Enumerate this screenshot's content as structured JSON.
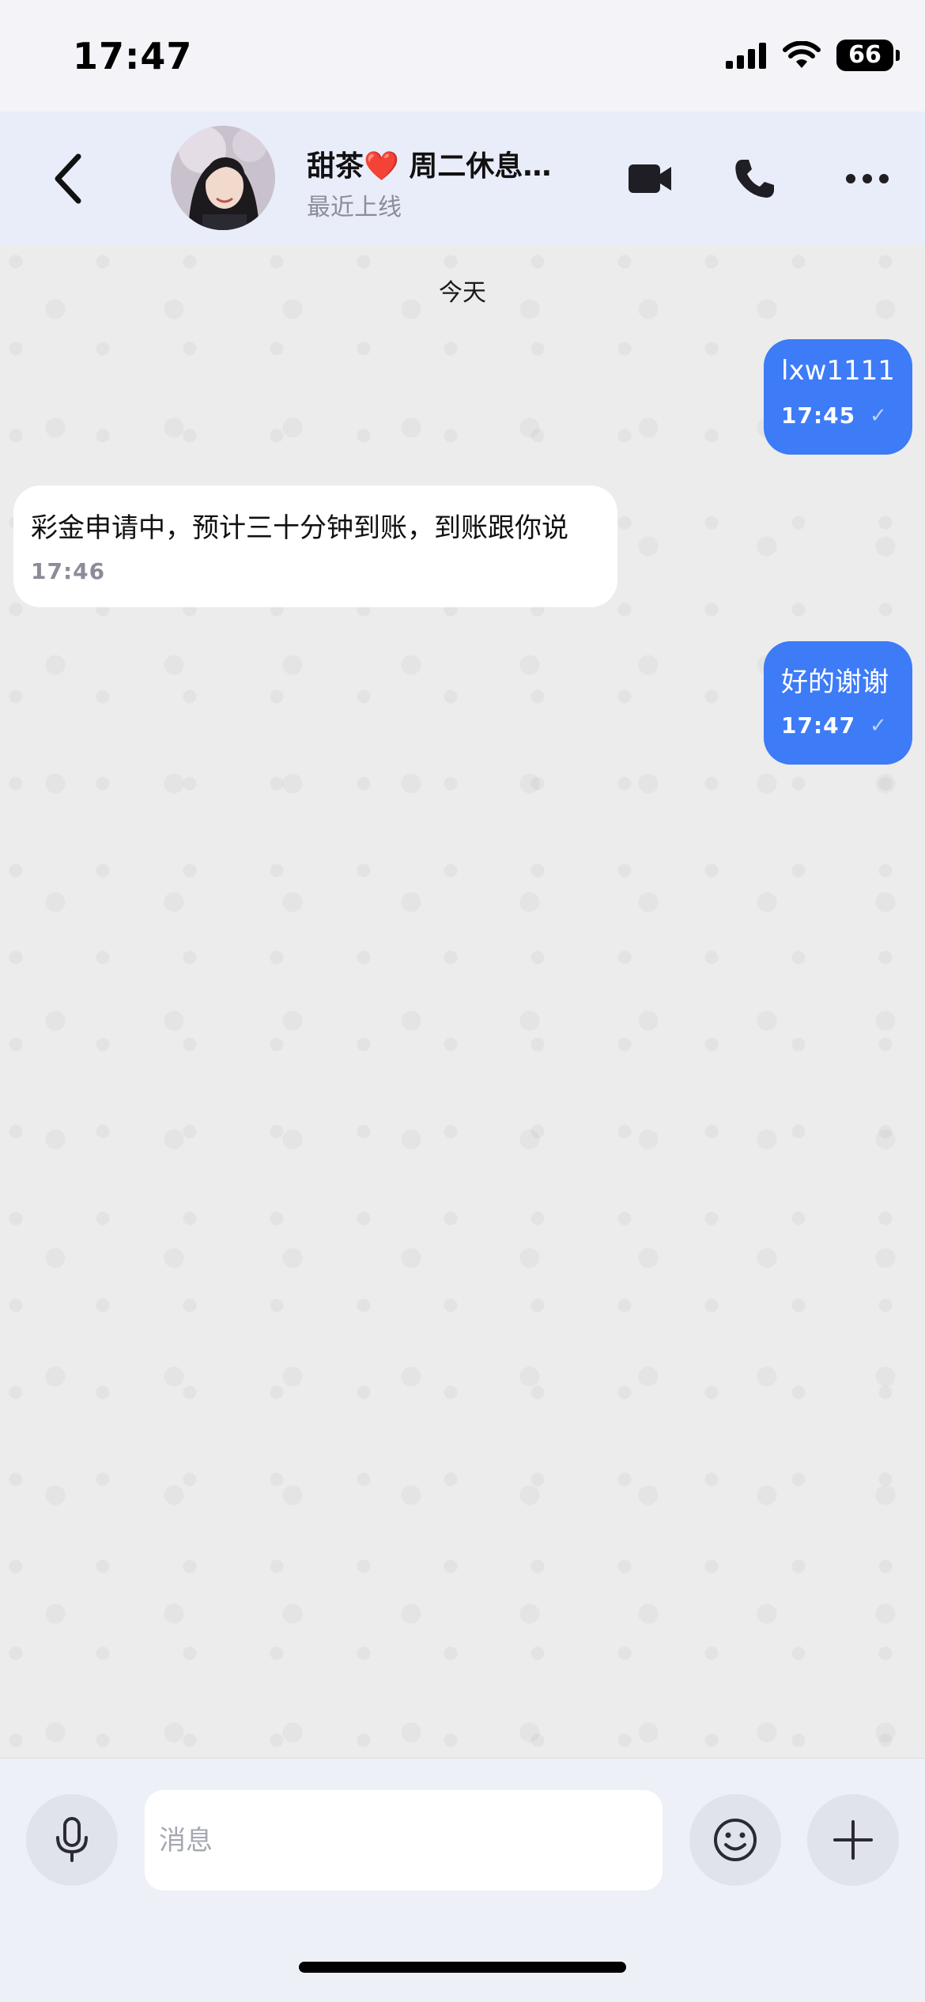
{
  "status_bar": {
    "time": "17:47",
    "battery": "66",
    "icons": [
      "signal-icon",
      "wifi-icon",
      "battery-icon"
    ]
  },
  "header": {
    "back_icon": "chevron-left-icon",
    "contact_name": "甜茶",
    "heart": "❤️",
    "contact_name_suffix": " 周二休息…",
    "contact_status": "最近上线",
    "video_icon": "video-camera-icon",
    "call_icon": "phone-icon",
    "more_icon": "more-horizontal-icon"
  },
  "chat": {
    "date_label": "今天",
    "messages": [
      {
        "direction": "out",
        "text": "lxw1111",
        "time": "17:45",
        "read_mark": "✓"
      },
      {
        "direction": "in",
        "text": "彩金申请中，预计三十分钟到账，到账跟你说",
        "time": "17:46"
      },
      {
        "direction": "out",
        "text": "好的谢谢",
        "time": "17:47",
        "read_mark": "✓"
      }
    ]
  },
  "input_bar": {
    "placeholder": "消息",
    "mic_icon": "microphone-icon",
    "emoji_icon": "smiley-icon",
    "plus_icon": "plus-icon"
  },
  "colors": {
    "outgoing_bubble": "#3d7bf7",
    "incoming_bubble": "#ffffff",
    "header_bg": "#e9edfa",
    "input_bar_bg": "#eef0f7"
  }
}
